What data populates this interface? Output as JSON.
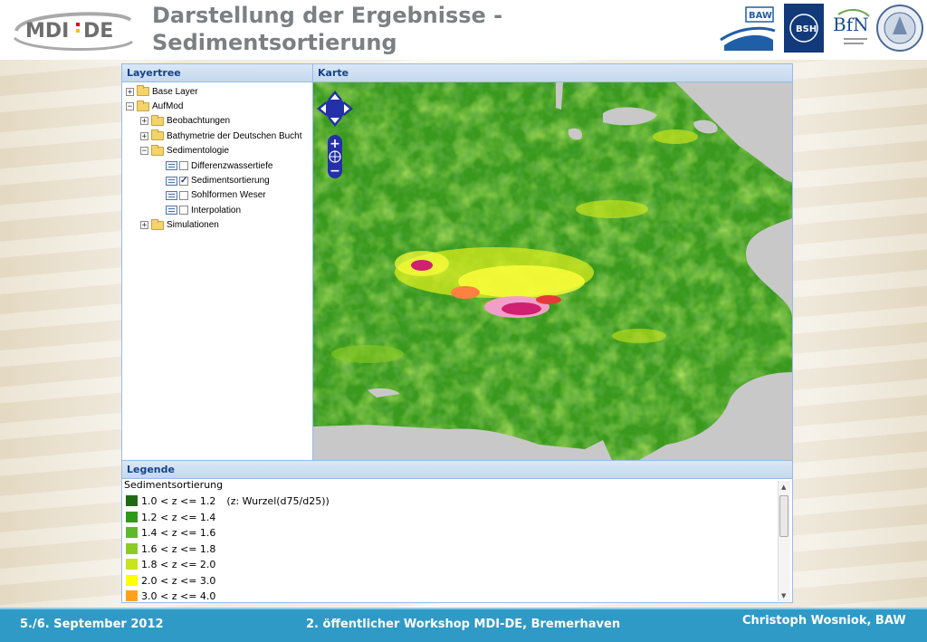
{
  "header": {
    "title_line1": "Darstellung der Ergebnisse -",
    "title_line2": "Sedimentsortierung",
    "logo_text": "MDI-DE",
    "partner_baw": "BAW",
    "partner_bsh": "BSH",
    "partner_bfn": "BfN"
  },
  "layertree": {
    "title": "Layertree",
    "nodes": [
      {
        "label": "Base Layer",
        "toggle": "+"
      },
      {
        "label": "AufMod",
        "toggle": "−"
      },
      {
        "label": "Beobachtungen",
        "toggle": "+"
      },
      {
        "label": "Bathymetrie der Deutschen Bucht",
        "toggle": "+"
      },
      {
        "label": "Sedimentologie",
        "toggle": "−"
      },
      {
        "label": "Differenzwassertiefe",
        "checked": ""
      },
      {
        "label": "Sedimentsortierung",
        "checked": "✓"
      },
      {
        "label": "Sohlformen Weser",
        "checked": ""
      },
      {
        "label": "Interpolation",
        "checked": ""
      },
      {
        "label": "Simulationen",
        "toggle": "+"
      }
    ]
  },
  "map": {
    "title": "Karte",
    "zoom_in": "+",
    "zoom_out": "−"
  },
  "legend": {
    "title": "Legende",
    "layer_name": "Sedimentsortierung",
    "items": [
      {
        "label": "1.0 < z <= 1.2",
        "note": "(z: Wurzel(d75/d25))",
        "color": "#1e6b12"
      },
      {
        "label": "1.2 < z <= 1.4",
        "note": "",
        "color": "#2f9a1a"
      },
      {
        "label": "1.4 < z <= 1.6",
        "note": "",
        "color": "#5fb82a"
      },
      {
        "label": "1.6 < z <= 1.8",
        "note": "",
        "color": "#8ccc22"
      },
      {
        "label": "1.8 < z <= 2.0",
        "note": "",
        "color": "#c8e41c"
      },
      {
        "label": "2.0 < z <= 3.0",
        "note": "",
        "color": "#ffff00"
      },
      {
        "label": "3.0 < z <= 4.0",
        "note": "",
        "color": "#ffa21a"
      }
    ]
  },
  "footer": {
    "date": "5./6. September 2012",
    "event": "2. öffentlicher Workshop MDI-DE, Bremerhaven",
    "author": "Christoph Wosniok, BAW"
  }
}
